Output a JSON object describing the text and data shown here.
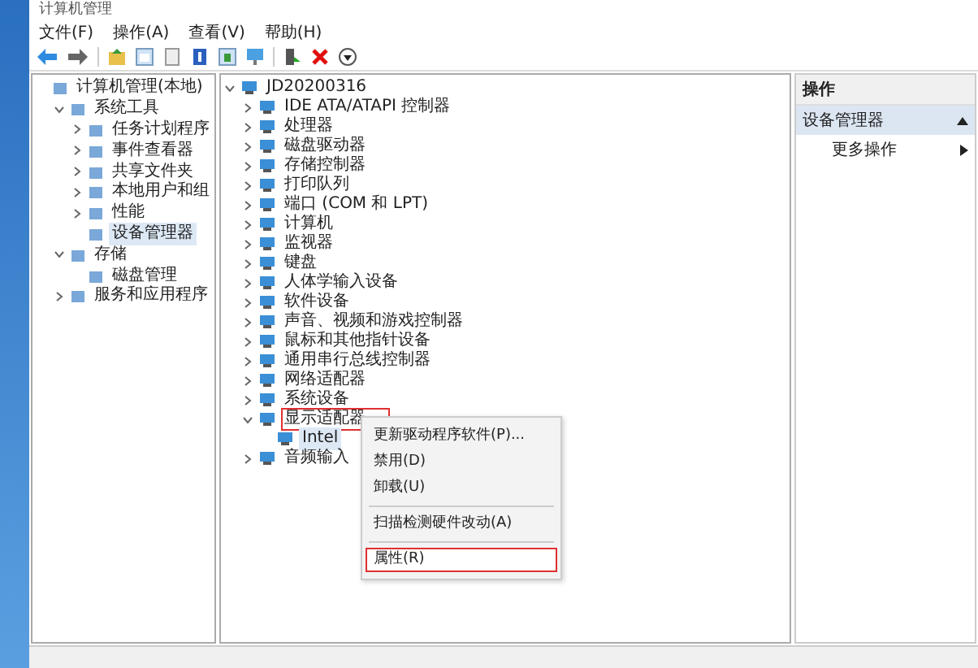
{
  "window": {
    "title": "计算机管理"
  },
  "menu": [
    "文件(F)",
    "操作(A)",
    "查看(V)",
    "帮助(H)"
  ],
  "left_tree": [
    {
      "label": "计算机管理(本地)",
      "children": [
        {
          "label": "系统工具",
          "expanded": true,
          "children": [
            {
              "label": "任务计划程序",
              "expanded": false,
              "selected": false
            },
            {
              "label": "事件查看器",
              "expanded": false,
              "selected": false
            },
            {
              "label": "共享文件夹",
              "expanded": false,
              "selected": false
            },
            {
              "label": "本地用户和组",
              "expanded": false,
              "selected": false
            },
            {
              "label": "性能",
              "expanded": false,
              "selected": false
            },
            {
              "label": "设备管理器",
              "selected": true
            }
          ]
        },
        {
          "label": "存储",
          "expanded": true,
          "children": [
            {
              "label": "磁盘管理",
              "selected": false
            }
          ]
        },
        {
          "label": "服务和应用程序",
          "expanded": false
        }
      ]
    }
  ],
  "device_tree": [
    {
      "label": "JD20200316",
      "expanded": true,
      "children": [
        {
          "label": "IDE ATA/ATAPI 控制器",
          "expanded": false,
          "highlighted": false
        },
        {
          "label": "处理器",
          "expanded": false,
          "highlighted": false
        },
        {
          "label": "磁盘驱动器",
          "expanded": false,
          "highlighted": false
        },
        {
          "label": "存储控制器",
          "expanded": false,
          "highlighted": false
        },
        {
          "label": "打印队列",
          "expanded": false,
          "highlighted": false
        },
        {
          "label": "端口 (COM 和 LPT)",
          "expanded": false,
          "highlighted": false
        },
        {
          "label": "计算机",
          "expanded": false,
          "highlighted": false
        },
        {
          "label": "监视器",
          "expanded": false,
          "highlighted": false
        },
        {
          "label": "键盘",
          "expanded": false,
          "highlighted": false
        },
        {
          "label": "人体学输入设备",
          "expanded": false,
          "highlighted": false
        },
        {
          "label": "软件设备",
          "expanded": false,
          "highlighted": false
        },
        {
          "label": "声音、视频和游戏控制器",
          "expanded": false,
          "highlighted": false
        },
        {
          "label": "鼠标和其他指针设备",
          "expanded": false,
          "highlighted": false
        },
        {
          "label": "通用串行总线控制器",
          "expanded": false,
          "highlighted": false
        },
        {
          "label": "网络适配器",
          "expanded": false,
          "highlighted": false
        },
        {
          "label": "系统设备",
          "expanded": false,
          "highlighted": false
        },
        {
          "label": "显示适配器",
          "expanded": true,
          "highlighted": true,
          "children": [
            {
              "label": "Intel",
              "selected": true
            }
          ]
        },
        {
          "label": "音频输入",
          "expanded": false,
          "highlighted": false
        }
      ]
    }
  ],
  "context_menu": {
    "items": [
      {
        "kind": "item",
        "label": "更新驱动程序软件(P)...",
        "highlighted": false
      },
      {
        "kind": "item",
        "label": "禁用(D)",
        "highlighted": false
      },
      {
        "kind": "item",
        "label": "卸载(U)",
        "highlighted": false
      },
      {
        "kind": "separator"
      },
      {
        "kind": "item",
        "label": "扫描检测硬件改动(A)",
        "highlighted": false
      },
      {
        "kind": "separator"
      },
      {
        "kind": "item",
        "label": "属性(R)",
        "highlighted": true
      }
    ]
  },
  "actions": {
    "title": "操作",
    "section": "设备管理器",
    "items": [
      "更多操作"
    ]
  }
}
